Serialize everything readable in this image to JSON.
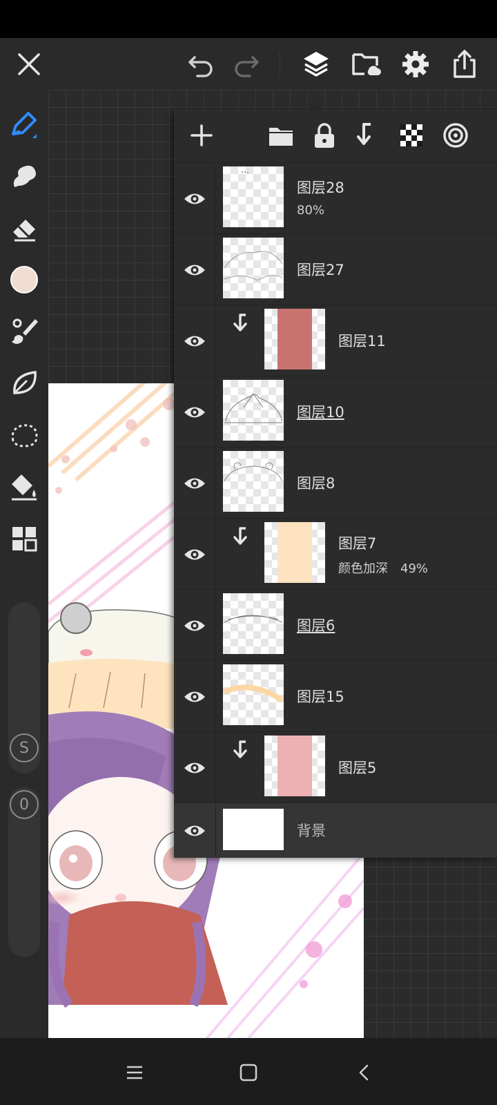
{
  "topbar": {
    "close_icon": "close-icon",
    "undo_icon": "undo-icon",
    "redo_icon": "redo-icon",
    "layers_icon": "layers-icon",
    "import_icon": "folder-import-icon",
    "settings_icon": "gear-icon",
    "share_icon": "share-icon"
  },
  "tools": [
    {
      "name": "pen-tool",
      "active": true
    },
    {
      "name": "smudge-tool"
    },
    {
      "name": "eraser-tool"
    },
    {
      "name": "color-swatch",
      "color": "#f0ddd0"
    },
    {
      "name": "brush-library"
    },
    {
      "name": "shape-tool"
    },
    {
      "name": "selection-tool"
    },
    {
      "name": "fill-tool"
    },
    {
      "name": "more-tools"
    }
  ],
  "sliders": {
    "size_label": "S",
    "opacity_label": "0"
  },
  "layer_panel": {
    "toolbar": [
      "add-layer-icon",
      "folder-icon",
      "lock-icon",
      "clip-icon",
      "alpha-lock-icon",
      "blend-icon"
    ],
    "layers": [
      {
        "name": "图层28",
        "sub": "80%",
        "clipped": false,
        "underline": false,
        "thumb": "sketch-dots"
      },
      {
        "name": "图层27",
        "sub": "",
        "clipped": false,
        "underline": false,
        "thumb": "lineart-cloud"
      },
      {
        "name": "图层11",
        "sub": "",
        "clipped": true,
        "underline": false,
        "thumb": "fill",
        "fill": "#c97370"
      },
      {
        "name": "图层10",
        "sub": "",
        "clipped": false,
        "underline": true,
        "thumb": "lineart-bow"
      },
      {
        "name": "图层8",
        "sub": "",
        "clipped": false,
        "underline": false,
        "thumb": "lineart-hat"
      },
      {
        "name": "图层7",
        "sub": "颜色加深　49%",
        "clipped": true,
        "underline": false,
        "thumb": "fill",
        "fill": "#fde3bf"
      },
      {
        "name": "图层6",
        "sub": "",
        "clipped": false,
        "underline": true,
        "thumb": "lineart-brim"
      },
      {
        "name": "图层15",
        "sub": "",
        "clipped": false,
        "underline": false,
        "thumb": "arc"
      },
      {
        "name": "图层5",
        "sub": "",
        "clipped": true,
        "underline": false,
        "thumb": "fill",
        "fill": "#edb1b2"
      },
      {
        "name": "背景",
        "sub": "",
        "clipped": false,
        "underline": false,
        "thumb": "white",
        "selected": true
      }
    ]
  },
  "navbar": {
    "menu_icon": "menu-icon",
    "home_icon": "home-icon",
    "back_icon": "back-icon"
  }
}
